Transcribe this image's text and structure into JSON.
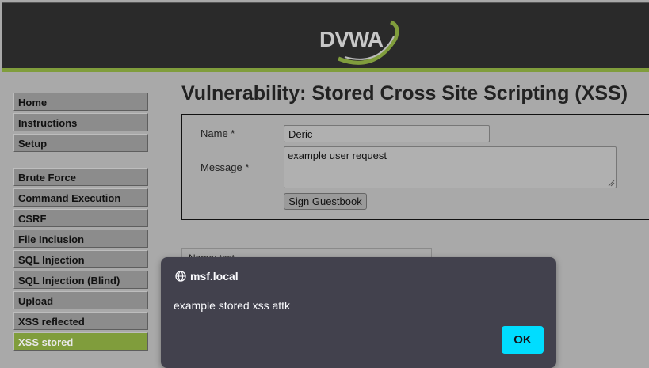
{
  "header": {
    "logo_text": "DVWA"
  },
  "sidebar": {
    "groups": [
      [
        {
          "label": "Home"
        },
        {
          "label": "Instructions"
        },
        {
          "label": "Setup"
        }
      ],
      [
        {
          "label": "Brute Force"
        },
        {
          "label": "Command Execution"
        },
        {
          "label": "CSRF"
        },
        {
          "label": "File Inclusion"
        },
        {
          "label": "SQL Injection"
        },
        {
          "label": "SQL Injection (Blind)"
        },
        {
          "label": "Upload"
        },
        {
          "label": "XSS reflected"
        },
        {
          "label": "XSS stored",
          "active": true
        }
      ]
    ]
  },
  "main": {
    "title": "Vulnerability: Stored Cross Site Scripting (XSS)",
    "form": {
      "name_label": "Name *",
      "name_value": "Deric",
      "message_label": "Message *",
      "message_value": "example user request",
      "submit_label": "Sign Guestbook"
    },
    "entry_partial_text": "Name: test"
  },
  "dialog": {
    "host": "msf.local",
    "message": "example stored xss attk",
    "ok_label": "OK"
  },
  "colors": {
    "accent_green": "#809d3c",
    "dialog_bg": "#42414d",
    "ok_button": "#00ddff"
  }
}
